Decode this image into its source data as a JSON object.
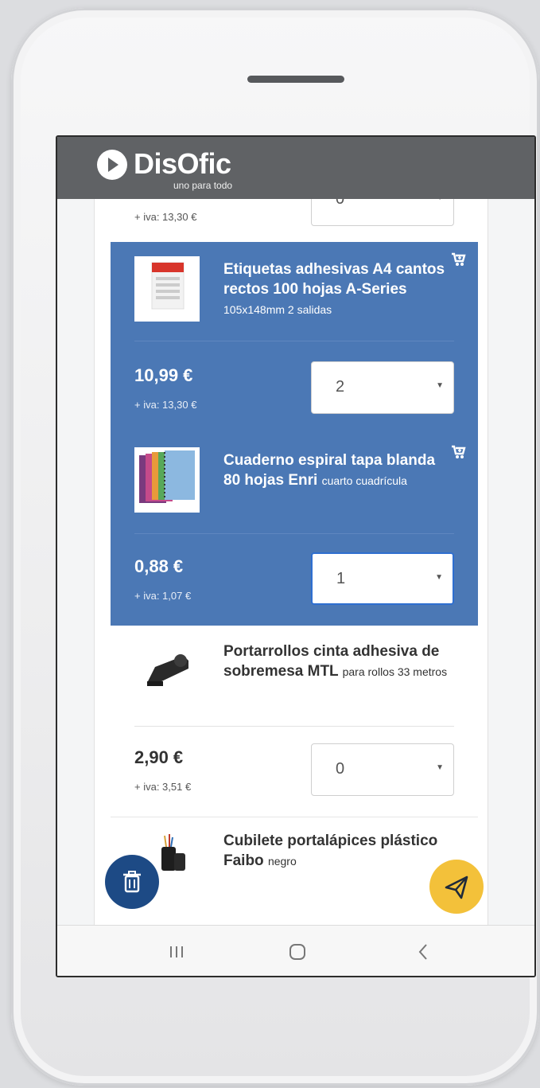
{
  "app": {
    "brand": "DisOfic",
    "tagline": "uno para todo"
  },
  "partial_top": {
    "iva": "+ iva: 13,30 €",
    "quantity": "0"
  },
  "products": [
    {
      "name": "Etiquetas adhesivas A4 cantos rectos 100 hojas A-Series",
      "detail": "105x148mm 2 salidas",
      "price": "10,99 €",
      "iva": "+ iva: 13,30 €",
      "quantity": "2",
      "selected": true
    },
    {
      "name": "Cuaderno espiral tapa blanda 80 hojas Enri",
      "detail": "cuarto cuadrícula",
      "price": "0,88 €",
      "iva": "+ iva: 1,07 €",
      "quantity": "1",
      "selected": true
    },
    {
      "name": "Portarrollos cinta adhesiva de sobremesa MTL",
      "detail": "para rollos 33 metros",
      "price": "2,90 €",
      "iva": "+ iva: 3,51 €",
      "quantity": "0",
      "selected": false
    },
    {
      "name": "Cubilete portalápices plástico Faibo",
      "detail": "negro",
      "selected": false
    }
  ],
  "icons": {
    "cart": "add-to-cart-icon",
    "trash": "trash-icon",
    "send": "paper-plane-icon",
    "nav_recent": "recent-apps-icon",
    "nav_home": "home-icon",
    "nav_back": "back-icon"
  },
  "colors": {
    "header": "#606265",
    "selected_row": "#4b78b5",
    "trash_button": "#1d4a85",
    "send_button": "#f3c13a"
  }
}
